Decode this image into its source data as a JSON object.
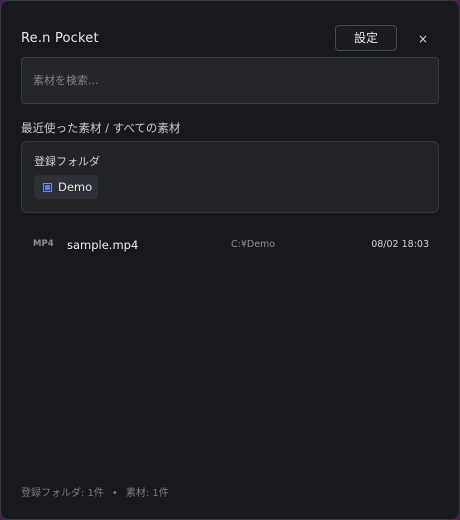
{
  "app": {
    "title": "Re.n Pocket",
    "settings_label": "設定",
    "close_glyph": "×"
  },
  "search": {
    "placeholder": "素材を検索...",
    "value": ""
  },
  "section": {
    "heading": "最近使った素材 / すべての素材"
  },
  "folders": {
    "title": "登録フォルダ",
    "items": [
      {
        "label": "Demo",
        "icon": "folder-square-icon",
        "icon_color": "#5b7fe0"
      }
    ]
  },
  "files": [
    {
      "type": "MP4",
      "name": "sample.mp4",
      "path": "C:¥Demo",
      "date": "08/02 18:03"
    }
  ],
  "status": {
    "folders": "登録フォルダ: 1件",
    "separator": "•",
    "materials": "素材: 1件"
  },
  "theme": {
    "background": "#18191d",
    "accent": "#5b7fe0"
  }
}
